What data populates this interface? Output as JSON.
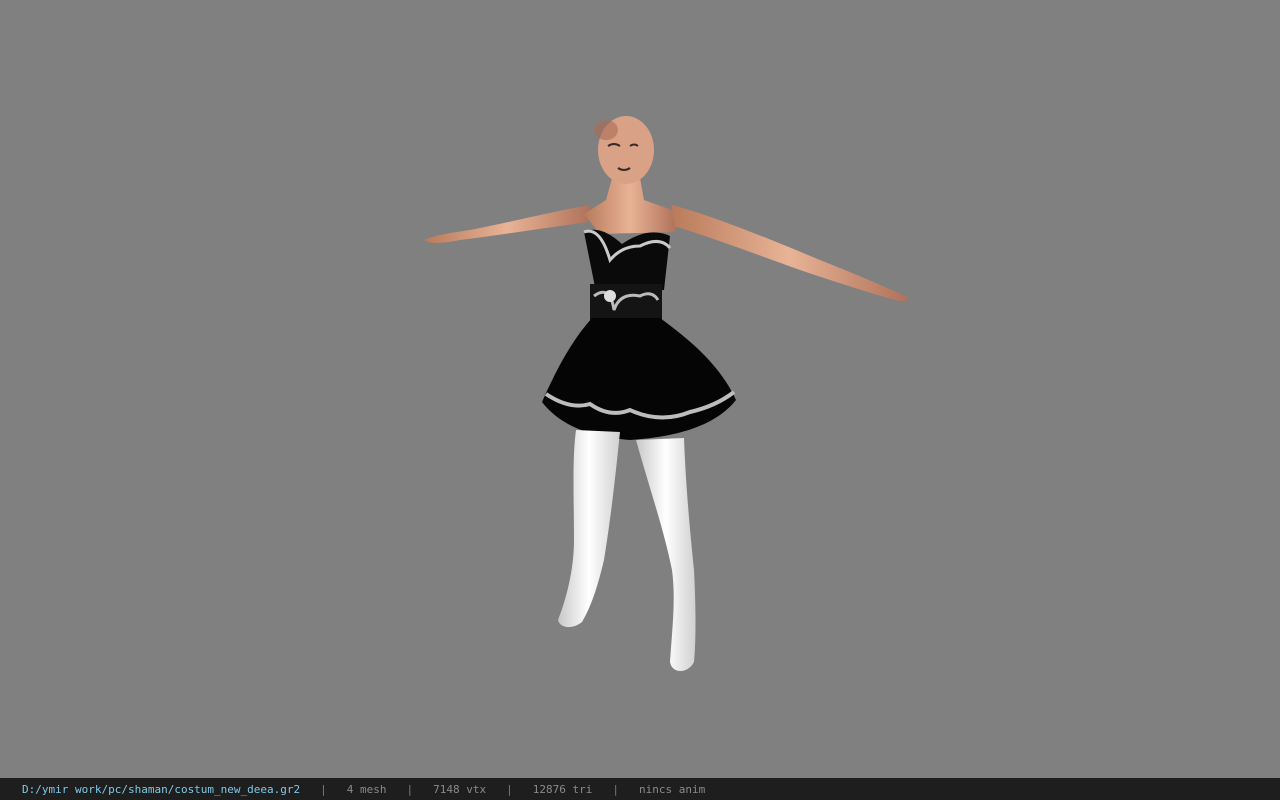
{
  "viewport": {
    "background": "#808080",
    "model": {
      "description_icon": "character-model"
    }
  },
  "status_bar": {
    "file_path": "D:/ymir work/pc/shaman/costum_new_deea.gr2",
    "separator": "|",
    "mesh": "4 mesh",
    "vertices": "7148 vtx",
    "triangles": "12876 tri",
    "animation": "nincs anim",
    "path_color": "#7fc8e8"
  }
}
